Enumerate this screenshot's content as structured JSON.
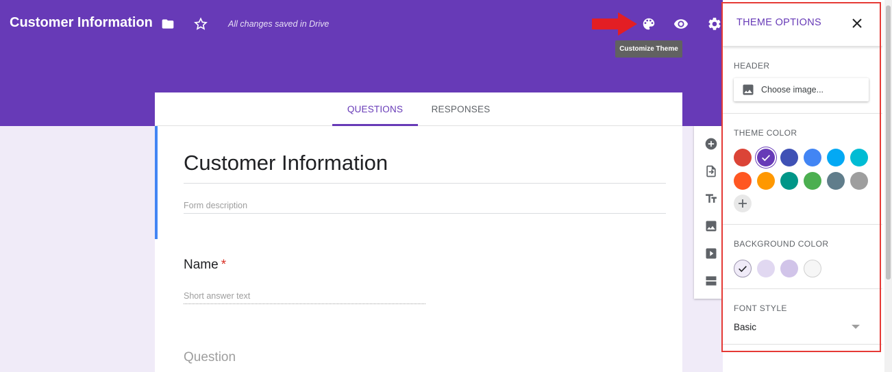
{
  "header": {
    "title": "Customer Information",
    "saved_status": "All changes saved in Drive",
    "tooltip": "Customize Theme",
    "icons": [
      "folder-icon",
      "star-icon",
      "palette-icon",
      "eye-icon",
      "gear-icon"
    ]
  },
  "tabs": [
    {
      "label": "QUESTIONS",
      "active": true
    },
    {
      "label": "RESPONSES",
      "active": false
    }
  ],
  "form": {
    "title": "Customer Information",
    "description_placeholder": "Form description",
    "question1": {
      "label": "Name",
      "required_mark": "*",
      "answer_placeholder": "Short answer text"
    },
    "question2_placeholder": "Question"
  },
  "toolbar_icons": [
    "add-question-icon",
    "import-questions-icon",
    "title-text-icon",
    "add-image-icon",
    "add-video-icon",
    "add-section-icon"
  ],
  "theme_panel": {
    "title": "THEME OPTIONS",
    "header_label": "HEADER",
    "choose_image": "Choose image...",
    "theme_color_label": "THEME COLOR",
    "theme_colors": [
      "#db4437",
      "#673ab7",
      "#3f51b5",
      "#4285f4",
      "#03a9f4",
      "#00bcd4",
      "#ff5722",
      "#ff9800",
      "#009688",
      "#4caf50",
      "#607d8b",
      "#9e9e9e"
    ],
    "selected_theme_color": "#673ab7",
    "background_color_label": "BACKGROUND COLOR",
    "background_colors": [
      "#f0ebf8",
      "#e1d8f1",
      "#d1c4e9",
      "#f6f6f6"
    ],
    "selected_background_color": "#f0ebf8",
    "font_style_label": "FONT STYLE",
    "font_style_value": "Basic"
  },
  "colors": {
    "brand": "#673ab7",
    "highlight": "#e53935",
    "arrow": "#e31e24"
  }
}
